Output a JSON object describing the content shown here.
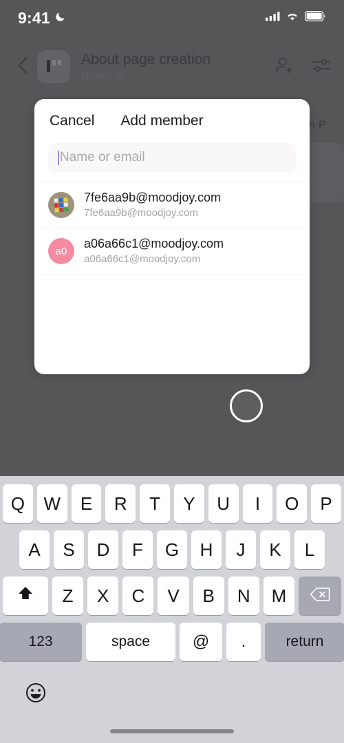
{
  "status_bar": {
    "time": "9:41",
    "dnd_icon": "moon-icon",
    "signal_icon": "cellular-signal-icon",
    "wifi_icon": "wifi-icon",
    "battery_icon": "battery-icon"
  },
  "header": {
    "back_icon": "chevron-left-icon",
    "board_icon": "board-thumbnail-icon",
    "title": "About page creation",
    "subtitle": "Board",
    "subtitle_chevron_icon": "chevron-down-icon",
    "add_member_icon": "person-add-icon",
    "settings_icon": "sliders-icon"
  },
  "background_board": {
    "column_title": "In P"
  },
  "fab": {
    "icon": "circle-outline-icon"
  },
  "modal": {
    "cancel_label": "Cancel",
    "title": "Add member",
    "search": {
      "placeholder": "Name or email",
      "value": ""
    },
    "results": [
      {
        "primary": "7fe6aa9b@moodjoy.com",
        "secondary": "7fe6aa9b@moodjoy.com",
        "avatar_type": "photo",
        "avatar_initials": "",
        "avatar_color": "#9e9279"
      },
      {
        "primary": "a06a66c1@moodjoy.com",
        "secondary": "a06a66c1@moodjoy.com",
        "avatar_type": "initials",
        "avatar_initials": "a0",
        "avatar_color": "#f58aa0"
      }
    ]
  },
  "keyboard": {
    "row1": [
      "Q",
      "W",
      "E",
      "R",
      "T",
      "Y",
      "U",
      "I",
      "O",
      "P"
    ],
    "row2": [
      "A",
      "S",
      "D",
      "F",
      "G",
      "H",
      "J",
      "K",
      "L"
    ],
    "row3_letters": [
      "Z",
      "X",
      "C",
      "V",
      "B",
      "N",
      "M"
    ],
    "shift_icon": "shift-arrow-icon",
    "backspace_icon": "backspace-icon",
    "numbers_label": "123",
    "space_label": "space",
    "at_label": "@",
    "dot_label": ".",
    "return_label": "return",
    "emoji_icon": "emoji-smiley-icon"
  },
  "colors": {
    "backdrop": "#565659",
    "modal_bg": "#ffffff",
    "keyboard_bg": "#d1d3d9",
    "key_bg": "#ffffff",
    "fn_key_bg": "#a6a9b4",
    "caret": "#9a8fd8",
    "avatar_pink": "#f58aa0",
    "secondary_text": "#a3a2a7"
  }
}
